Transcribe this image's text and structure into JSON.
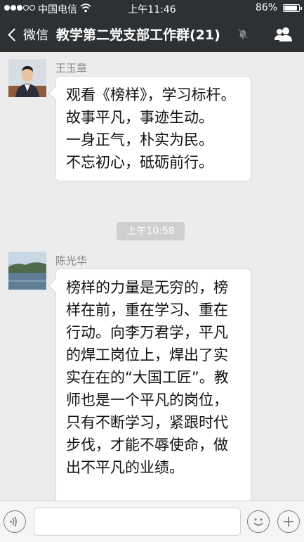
{
  "status_bar": {
    "carrier": "中国电信",
    "time": "上午11:46",
    "battery": "86%",
    "battery_level": 0.86,
    "signal_full_dots": 3,
    "signal_total_dots": 5
  },
  "nav": {
    "back_label": "微信",
    "title": "教学第二党支部工作群(21)"
  },
  "messages": [
    {
      "sender": "王玉章",
      "text": "观看《榜样》，学习标杆。\n故事平凡，事迹生动。\n一身正气，朴实为民。\n不忘初心，砥砺前行。"
    },
    {
      "sender": "陈光华",
      "text": "榜样的力量是无穷的，榜样在前，重在学习、重在行动。向李万君学，平凡的焊工岗位上，焊出了实实在在的“大国工匠”。教师也是一个平凡的岗位，只有不断学习，紧跟时代步伐，才能不辱使命，做出不平凡的业绩。"
    }
  ],
  "timestamp": "上午10:58",
  "icons": {
    "back": "chevron-left-icon",
    "mute": "muted-bell-icon",
    "contacts": "group-contacts-icon",
    "voice": "voice-icon",
    "emoji": "emoji-icon",
    "plus": "plus-icon",
    "wifi": "wifi-icon"
  }
}
